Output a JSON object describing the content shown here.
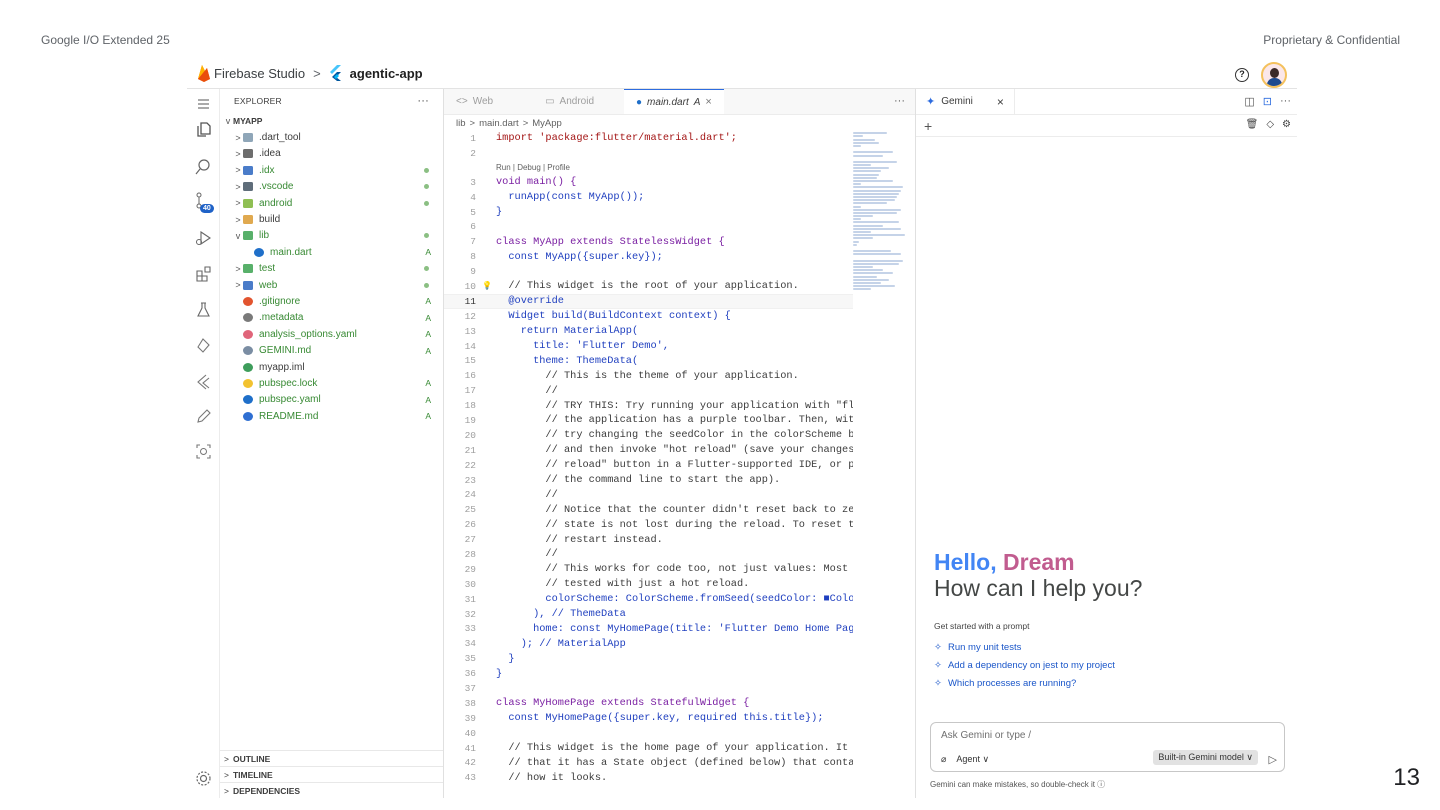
{
  "slide": {
    "left_label": "Google I/O Extended 25",
    "right_label": "Proprietary & Confidential",
    "page_number": "13"
  },
  "header": {
    "app_name": "Firebase Studio",
    "separator": ">",
    "project": "agentic-app",
    "help": "?"
  },
  "activity": {
    "badge": "40"
  },
  "explorer": {
    "title": "EXPLORER",
    "more": "···",
    "root": "MYAPP",
    "items": [
      {
        "label": ".dart_tool",
        "chev": ">",
        "indent": 0,
        "icon": "#8fa6b8",
        "status": ""
      },
      {
        "label": ".idea",
        "chev": ">",
        "indent": 0,
        "icon": "#6d6d6d",
        "status": ""
      },
      {
        "label": ".idx",
        "chev": ">",
        "indent": 0,
        "icon": "#4a7cc9",
        "status": "dot"
      },
      {
        "label": ".vscode",
        "chev": ">",
        "indent": 0,
        "icon": "#5f6d7a",
        "status": "dot"
      },
      {
        "label": "android",
        "chev": ">",
        "indent": 0,
        "icon": "#8fbf53",
        "status": "dot"
      },
      {
        "label": "build",
        "chev": ">",
        "indent": 0,
        "icon": "#e0a94f",
        "status": ""
      },
      {
        "label": "lib",
        "chev": "v",
        "indent": 0,
        "icon": "#58b06a",
        "status": "dot"
      },
      {
        "label": "main.dart",
        "chev": "",
        "indent": 1,
        "icon": "#1f6fc9",
        "status": "A"
      },
      {
        "label": "test",
        "chev": ">",
        "indent": 0,
        "icon": "#58b06a",
        "status": "dot"
      },
      {
        "label": "web",
        "chev": ">",
        "indent": 0,
        "icon": "#4a7cc9",
        "status": "dot"
      },
      {
        "label": ".gitignore",
        "chev": "",
        "indent": 0,
        "icon": "#e2542f",
        "status": "A"
      },
      {
        "label": ".metadata",
        "chev": "",
        "indent": 0,
        "icon": "#7a7a7a",
        "status": "A"
      },
      {
        "label": "analysis_options.yaml",
        "chev": "",
        "indent": 0,
        "icon": "#e0657a",
        "status": "A"
      },
      {
        "label": "GEMINI.md",
        "chev": "",
        "indent": 0,
        "icon": "#7a8da3",
        "status": "A"
      },
      {
        "label": "myapp.iml",
        "chev": "",
        "indent": 0,
        "icon": "#3e9d5b",
        "status": ""
      },
      {
        "label": "pubspec.lock",
        "chev": "",
        "indent": 0,
        "icon": "#f2c230",
        "status": "A"
      },
      {
        "label": "pubspec.yaml",
        "chev": "",
        "indent": 0,
        "icon": "#1f6fc9",
        "status": "A"
      },
      {
        "label": "README.md",
        "chev": "",
        "indent": 0,
        "icon": "#2f6fd2",
        "status": "A"
      }
    ],
    "sections": [
      "OUTLINE",
      "TIMELINE",
      "DEPENDENCIES"
    ]
  },
  "editor": {
    "tabs": [
      {
        "label": "Web",
        "icon": "<>",
        "active": false
      },
      {
        "label": "Android",
        "icon": "▭",
        "active": false
      },
      {
        "label": "main.dart",
        "icon": "●",
        "active": true,
        "status": "A",
        "close": "×"
      }
    ],
    "more": "···",
    "breadcrumb": [
      "lib",
      ">",
      "main.dart",
      ">",
      "MyApp"
    ],
    "codelens": "Run | Debug | Profile",
    "current_line": 11,
    "lines": [
      {
        "n": "1",
        "t": "import 'package:flutter/material.dart';"
      },
      {
        "n": "2",
        "t": ""
      },
      {
        "n": "3",
        "t": "void main() {"
      },
      {
        "n": "4",
        "t": "  runApp(const MyApp());"
      },
      {
        "n": "5",
        "t": "}"
      },
      {
        "n": "6",
        "t": ""
      },
      {
        "n": "7",
        "t": "class MyApp extends StatelessWidget {"
      },
      {
        "n": "8",
        "t": "  const MyApp({super.key});"
      },
      {
        "n": "9",
        "t": ""
      },
      {
        "n": "10",
        "t": "  // This widget is the root of your application."
      },
      {
        "n": "11",
        "t": "  @override"
      },
      {
        "n": "12",
        "t": "  Widget build(BuildContext context) {"
      },
      {
        "n": "13",
        "t": "    return MaterialApp("
      },
      {
        "n": "14",
        "t": "      title: 'Flutter Demo',"
      },
      {
        "n": "15",
        "t": "      theme: ThemeData("
      },
      {
        "n": "16",
        "t": "        // This is the theme of your application."
      },
      {
        "n": "17",
        "t": "        //"
      },
      {
        "n": "18",
        "t": "        // TRY THIS: Try running your application with \"flutte"
      },
      {
        "n": "19",
        "t": "        // the application has a purple toolbar. Then, without"
      },
      {
        "n": "20",
        "t": "        // try changing the seedColor in the colorScheme belo"
      },
      {
        "n": "21",
        "t": "        // and then invoke \"hot reload\" (save your changes or"
      },
      {
        "n": "22",
        "t": "        // reload\" button in a Flutter-supported IDE, or pres"
      },
      {
        "n": "23",
        "t": "        // the command line to start the app)."
      },
      {
        "n": "24",
        "t": "        //"
      },
      {
        "n": "25",
        "t": "        // Notice that the counter didn't reset back to zero;"
      },
      {
        "n": "26",
        "t": "        // state is not lost during the reload. To reset the s"
      },
      {
        "n": "27",
        "t": "        // restart instead."
      },
      {
        "n": "28",
        "t": "        //"
      },
      {
        "n": "29",
        "t": "        // This works for code too, not just values: Most code"
      },
      {
        "n": "30",
        "t": "        // tested with just a hot reload."
      },
      {
        "n": "31",
        "t": "        colorScheme: ColorScheme.fromSeed(seedColor: ■Colors"
      },
      {
        "n": "32",
        "t": "      ), // ThemeData"
      },
      {
        "n": "33",
        "t": "      home: const MyHomePage(title: 'Flutter Demo Home Page'),"
      },
      {
        "n": "34",
        "t": "    ); // MaterialApp"
      },
      {
        "n": "35",
        "t": "  }"
      },
      {
        "n": "36",
        "t": "}"
      },
      {
        "n": "37",
        "t": ""
      },
      {
        "n": "38",
        "t": "class MyHomePage extends StatefulWidget {"
      },
      {
        "n": "39",
        "t": "  const MyHomePage({super.key, required this.title});"
      },
      {
        "n": "40",
        "t": ""
      },
      {
        "n": "41",
        "t": "  // This widget is the home page of your application. It is s"
      },
      {
        "n": "42",
        "t": "  // that it has a State object (defined below) that contains"
      },
      {
        "n": "43",
        "t": "  // how it looks."
      }
    ]
  },
  "gemini": {
    "tab_label": "Gemini",
    "tab_close": "×",
    "new": "+",
    "greeting_hello": "Hello, ",
    "greeting_name": "Dream",
    "question": "How can I help you?",
    "get_started": "Get started with a prompt",
    "prompts": [
      "Run my unit tests",
      "Add a dependency on jest to my project",
      "Which processes are running?"
    ],
    "input_placeholder": "Ask Gemini or type /",
    "mode": "Agent ∨",
    "model": "Built-in Gemini model ∨",
    "disclaimer": "Gemini can make mistakes, so double-check it ⓘ"
  }
}
